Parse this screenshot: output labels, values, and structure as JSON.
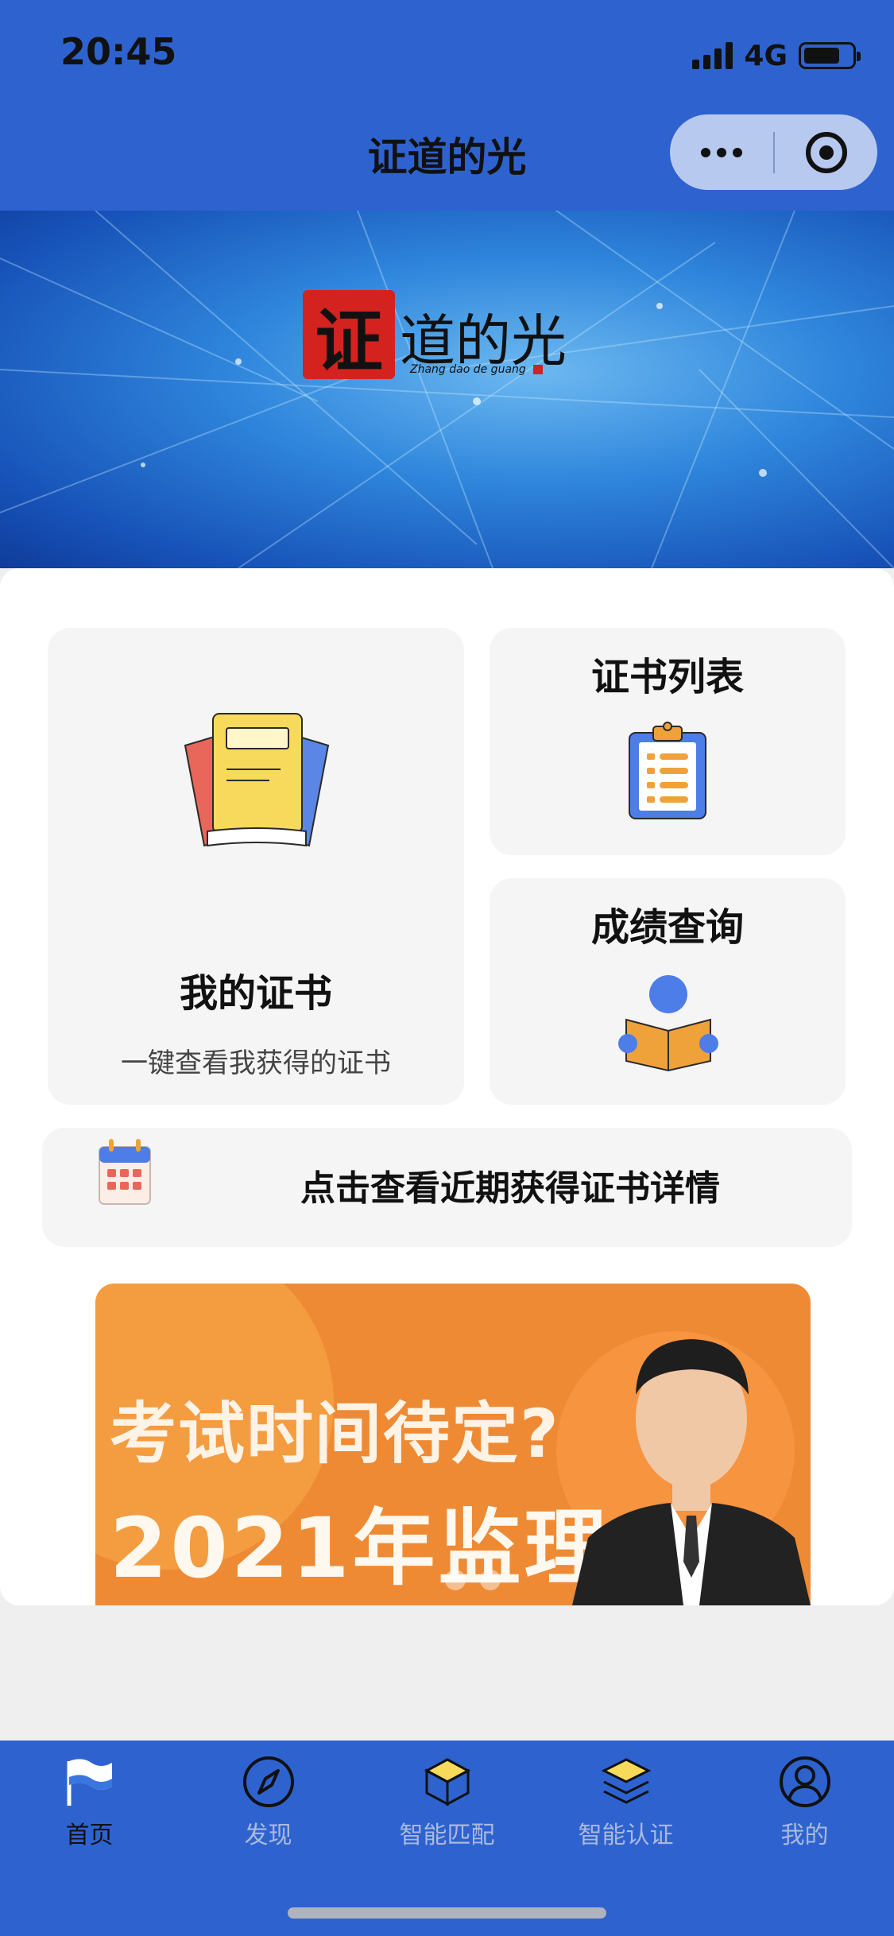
{
  "status_bar": {
    "time": "20:45",
    "network": "4G",
    "battery_level": 0.75
  },
  "nav": {
    "title": "证道的光",
    "more_icon": "ellipsis-icon",
    "close_icon": "target-icon"
  },
  "banner": {
    "logo_seal_char": "证",
    "logo_text": "道的光",
    "logo_pinyin": "Zhang dao de guang"
  },
  "cards": {
    "my_certificates": {
      "title": "我的证书",
      "subtitle": "一键查看我获得的证书",
      "icon": "books-icon"
    },
    "certificate_list": {
      "title": "证书列表",
      "icon": "clipboard-list-icon"
    },
    "score_query": {
      "title": "成绩查询",
      "icon": "reader-icon"
    },
    "recent": {
      "text": "点击查看近期获得证书详情",
      "icon": "calendar-icon"
    }
  },
  "promo": {
    "line1": "考试时间待定?",
    "line2": "2021年监理",
    "page_count": 2,
    "active_index": 0
  },
  "tabbar": {
    "items": [
      {
        "label": "首页",
        "icon": "flag-icon",
        "active": true
      },
      {
        "label": "发现",
        "icon": "compass-icon",
        "active": false
      },
      {
        "label": "智能匹配",
        "icon": "box-icon",
        "active": false
      },
      {
        "label": "智能认证",
        "icon": "layers-icon",
        "active": false
      },
      {
        "label": "我的",
        "icon": "user-icon",
        "active": false
      }
    ]
  },
  "colors": {
    "brand_blue": "#2e63cf",
    "promo_orange": "#ee8a34"
  }
}
